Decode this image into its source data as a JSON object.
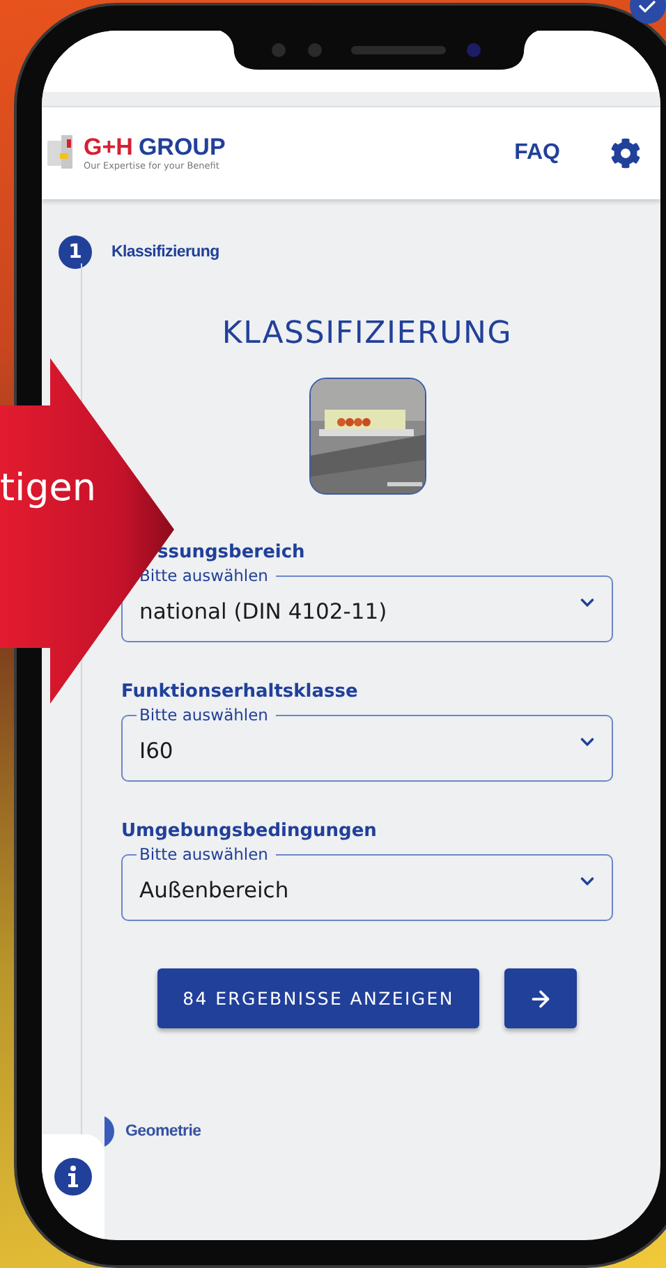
{
  "header": {
    "logo": {
      "name_part_1": "G+H",
      "name_part_2": "GROUP",
      "tagline": "Our Expertise for your Benefit"
    },
    "links": [
      {
        "label": "FAQ"
      }
    ]
  },
  "steps": [
    {
      "number": "1",
      "label": "Klassifizierung",
      "selected": true
    },
    {
      "label": "Geometrie",
      "selected": false
    }
  ],
  "section": {
    "title": "KLASSIFIZIERUNG"
  },
  "fields": [
    {
      "label": "ssungsbereich",
      "hint": "Bitte auswählen",
      "value": "national (DIN 4102-11)"
    },
    {
      "label": "Funktionserhaltsklasse",
      "hint": "Bitte auswählen",
      "value": "I60"
    },
    {
      "label": "Umgebungsbedingungen",
      "hint": "Bitte auswählen",
      "value": "Außenbereich"
    }
  ],
  "buttons": {
    "results": "84 ERGEBNISSE ANZEIGEN"
  },
  "callout": {
    "text": "tigen"
  }
}
